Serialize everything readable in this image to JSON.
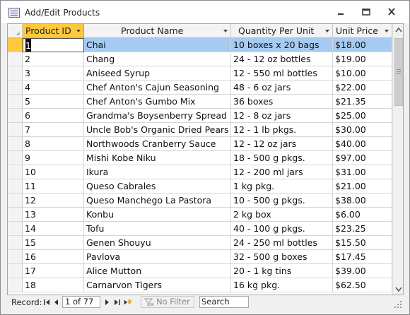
{
  "window": {
    "title": "Add/Edit Products"
  },
  "columns": [
    {
      "label": "Product ID"
    },
    {
      "label": "Product Name"
    },
    {
      "label": "Quantity Per Unit"
    },
    {
      "label": "Unit Price"
    }
  ],
  "rows": [
    {
      "id": "1",
      "name": "Chai",
      "qty": "10 boxes x 20 bags",
      "price": "$18.00"
    },
    {
      "id": "2",
      "name": "Chang",
      "qty": "24 - 12 oz bottles",
      "price": "$19.00"
    },
    {
      "id": "3",
      "name": "Aniseed Syrup",
      "qty": "12 - 550 ml bottles",
      "price": "$10.00"
    },
    {
      "id": "4",
      "name": "Chef Anton's Cajun Seasoning",
      "qty": "48 - 6 oz jars",
      "price": "$22.00"
    },
    {
      "id": "5",
      "name": "Chef Anton's Gumbo Mix",
      "qty": "36 boxes",
      "price": "$21.35"
    },
    {
      "id": "6",
      "name": "Grandma's Boysenberry Spread",
      "qty": "12 - 8 oz jars",
      "price": "$25.00"
    },
    {
      "id": "7",
      "name": "Uncle Bob's Organic Dried Pears",
      "qty": "12 - 1 lb pkgs.",
      "price": "$30.00"
    },
    {
      "id": "8",
      "name": "Northwoods Cranberry Sauce",
      "qty": "12 - 12 oz jars",
      "price": "$40.00"
    },
    {
      "id": "9",
      "name": "Mishi Kobe Niku",
      "qty": "18 - 500 g pkgs.",
      "price": "$97.00"
    },
    {
      "id": "10",
      "name": "Ikura",
      "qty": "12 - 200 ml jars",
      "price": "$31.00"
    },
    {
      "id": "11",
      "name": "Queso Cabrales",
      "qty": "1 kg pkg.",
      "price": "$21.00"
    },
    {
      "id": "12",
      "name": "Queso Manchego La Pastora",
      "qty": "10 - 500 g pkgs.",
      "price": "$38.00"
    },
    {
      "id": "13",
      "name": "Konbu",
      "qty": "2 kg box",
      "price": "$6.00"
    },
    {
      "id": "14",
      "name": "Tofu",
      "qty": "40 - 100 g pkgs.",
      "price": "$23.25"
    },
    {
      "id": "15",
      "name": "Genen Shouyu",
      "qty": "24 - 250 ml bottles",
      "price": "$15.50"
    },
    {
      "id": "16",
      "name": "Pavlova",
      "qty": "32 - 500 g boxes",
      "price": "$17.45"
    },
    {
      "id": "17",
      "name": "Alice Mutton",
      "qty": "20 - 1 kg tins",
      "price": "$39.00"
    },
    {
      "id": "18",
      "name": "Carnarvon Tigers",
      "qty": "16 kg pkg.",
      "price": "$62.50"
    }
  ],
  "navigator": {
    "record_label": "Record:",
    "position": "1 of 77",
    "filter_label": "No Filter",
    "search_placeholder": "Search"
  },
  "icons": {
    "app": "datasheet-form-icon",
    "minimize": "minimize-icon",
    "restore": "restore-icon",
    "close": "close-icon",
    "filter": "filter-off-icon"
  },
  "colors": {
    "selected_header": "#ffc83d",
    "selected_row": "#a6cbf2"
  }
}
